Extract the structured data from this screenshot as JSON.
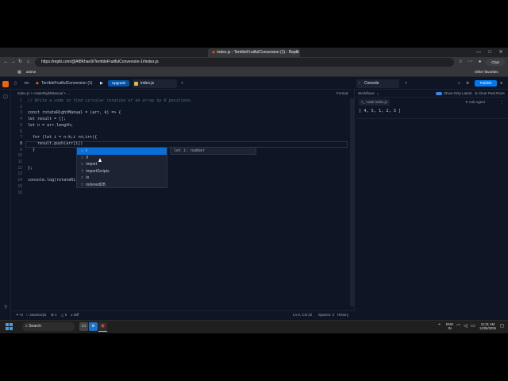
{
  "browser": {
    "tab_title": "index.js - TerribleFruitfulConversion (1) - Replit",
    "tab_close": "×",
    "url": "https://replit.com/@Af8Khan9/TerribleFruitfulConversion-1#index.js",
    "chat_label": "Chat",
    "bookmark": "anime",
    "other_favorites": "Other favorites"
  },
  "replit": {
    "project_name": "TerribleFruitfulConversion (1)",
    "upgrade_label": "Upgrade",
    "file_tab": "index.js",
    "console_tab": "Console",
    "publish_label": "Publish",
    "breadcrumb": "index.js  >  rotateRightManual  >  ...",
    "format_label": "Format",
    "search_icon": "search-icon",
    "accent": "#f26207"
  },
  "editor": {
    "line_numbers": [
      "1",
      "2",
      "3",
      "4",
      "5",
      "6",
      "7",
      "8",
      "9",
      "10",
      "11",
      "12",
      "13",
      "14",
      "15",
      "16"
    ],
    "lines": [
      "// Write a code to find circular rotation of an array by K positions.",
      "",
      "const rotateRightManual = (arr, k) => {",
      "let result = [];",
      "let n = arr.length;",
      "",
      "  for (let i = n-k;i <n;i++){",
      "    result.push(arr[i])",
      "  }",
      "",
      "",
      "};",
      "",
      "",
      "console.log(rotateRi",
      ""
    ],
    "suggestions": [
      "i",
      "if",
      "import",
      "importScripts",
      "in",
      "indexedDB"
    ],
    "suggestion_kinds": [
      "v",
      "□",
      "□",
      "f",
      "□",
      "□"
    ],
    "suggestion_detail": "let i: number"
  },
  "status": {
    "ai": "AI",
    "language": "JavaScript",
    "errors": "1",
    "warnings": "0",
    "diff": "Diff",
    "position": "Ln 8, Col 22",
    "spaces": "Spaces: 2",
    "history": "History"
  },
  "console": {
    "workflows": "Workflows",
    "show_only_latest": "Show Only Latest",
    "clear_past_runs": "Clear Past Runs",
    "ask_agent": "Ask Agent",
    "run_label": "node index.js",
    "output": "[ 4, 5, 1, 2, 3 ]"
  },
  "taskbar": {
    "search": "Search",
    "lang": "ENG",
    "lang_region": "IN",
    "time": "11:31 AM",
    "date": "12/06/2025"
  }
}
